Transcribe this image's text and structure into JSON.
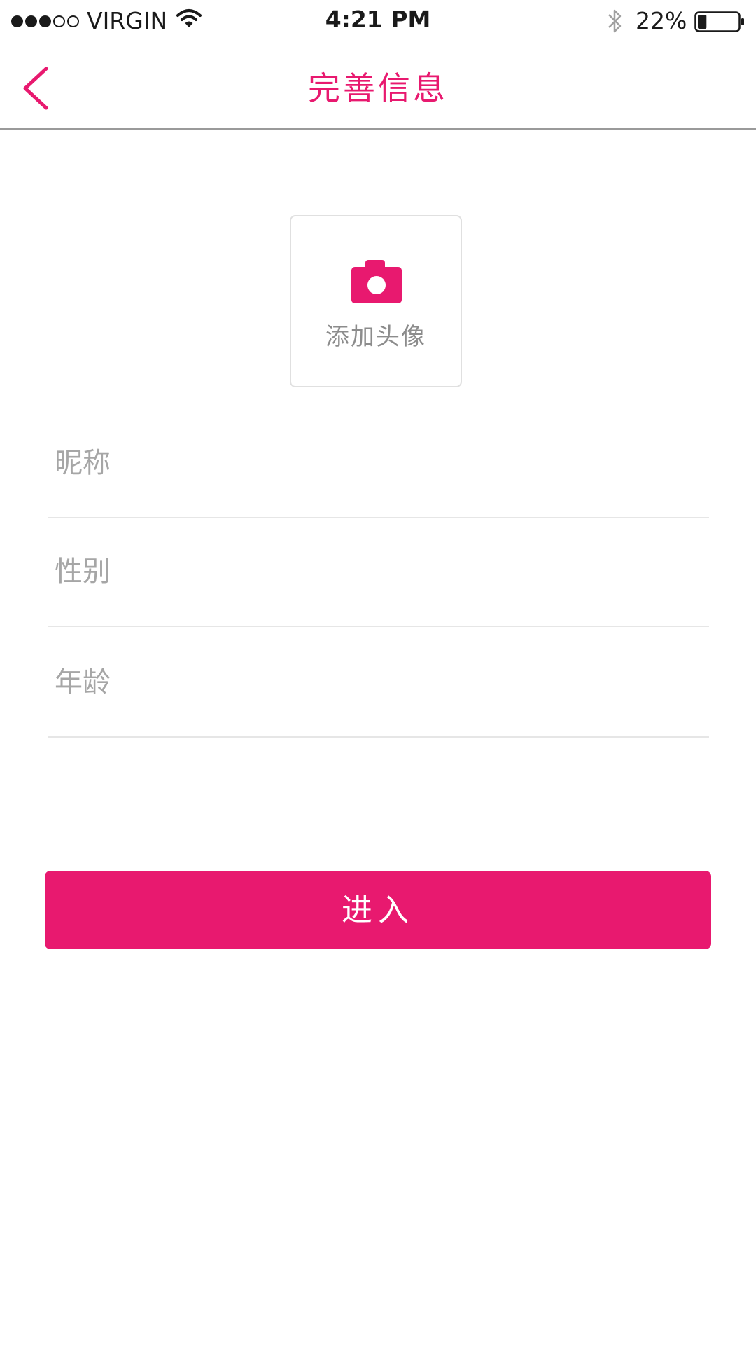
{
  "status_bar": {
    "signal_bars": 3,
    "signal_total": 5,
    "carrier": "VIRGIN",
    "time": "4:21 PM",
    "battery_percent": "22%",
    "battery_level": 0.22
  },
  "nav": {
    "back_icon": "chevron-left-icon",
    "title": "完善信息"
  },
  "avatar": {
    "icon": "camera-icon",
    "label": "添加头像"
  },
  "form": {
    "nickname": {
      "placeholder": "昵称",
      "value": ""
    },
    "gender": {
      "placeholder": "性别",
      "value": ""
    },
    "age": {
      "placeholder": "年龄",
      "value": ""
    }
  },
  "actions": {
    "enter_label": "进入"
  },
  "colors": {
    "accent": "#e8196f",
    "placeholder": "#a6a6a6",
    "divider": "#e6e6e6"
  }
}
